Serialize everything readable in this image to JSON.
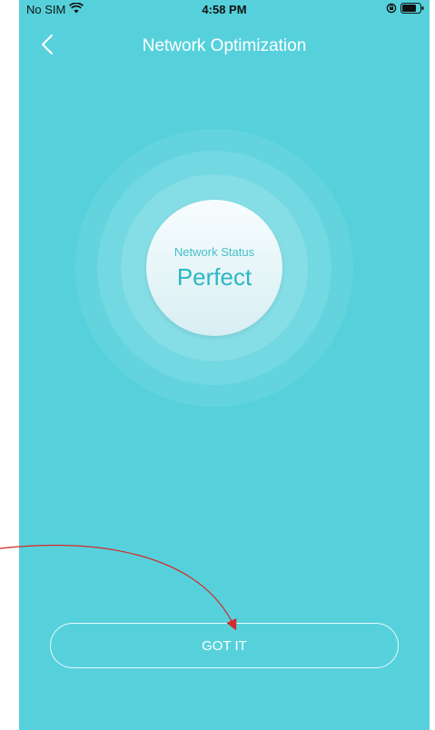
{
  "status_bar": {
    "carrier": "No SIM",
    "time": "4:58 PM",
    "icons": [
      "wifi-icon",
      "rotation-lock-icon",
      "battery-icon"
    ]
  },
  "nav": {
    "back_icon": "chevron-left-icon",
    "title": "Network Optimization"
  },
  "status": {
    "label": "Network Status",
    "value": "Perfect"
  },
  "actions": {
    "got_it_label": "GOT IT"
  },
  "annotation": {
    "arrow_color": "#d42a2a",
    "target": "got-it-button"
  },
  "colors": {
    "background": "#56d1dc",
    "accent": "#2cb7c4"
  }
}
